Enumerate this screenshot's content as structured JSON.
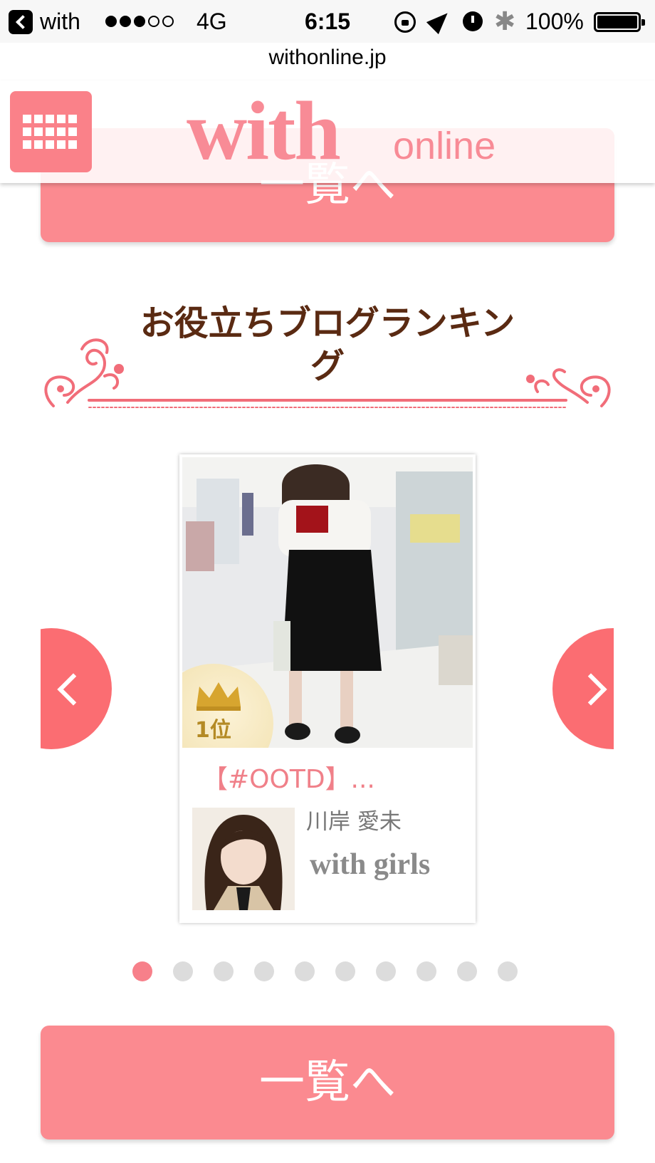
{
  "status_bar": {
    "back_app": "with",
    "network": "4G",
    "time": "6:15",
    "battery": "100%",
    "signal_dots_filled": 3,
    "signal_dots_total": 5
  },
  "browser": {
    "url": "withonline.jp"
  },
  "header": {
    "logo_main": "with",
    "logo_sub": "online",
    "menu_icon": "grid-icon"
  },
  "top_button": {
    "label": "一覧へ"
  },
  "section": {
    "title": "お役立ちブログランキング"
  },
  "carousel": {
    "card": {
      "rank_label": "1位",
      "title": "【#OOTD】...",
      "author_name": "川岸 愛未",
      "author_brand": "with girls"
    },
    "pages": 10,
    "active_page": 1
  },
  "bottom_button": {
    "label": "一覧へ"
  },
  "colors": {
    "accent": "#fb8a90",
    "arrow": "#fb6d72",
    "title": "#5a2a12",
    "dot_active": "#f7808a",
    "dot_inactive": "#dcdcdc"
  }
}
